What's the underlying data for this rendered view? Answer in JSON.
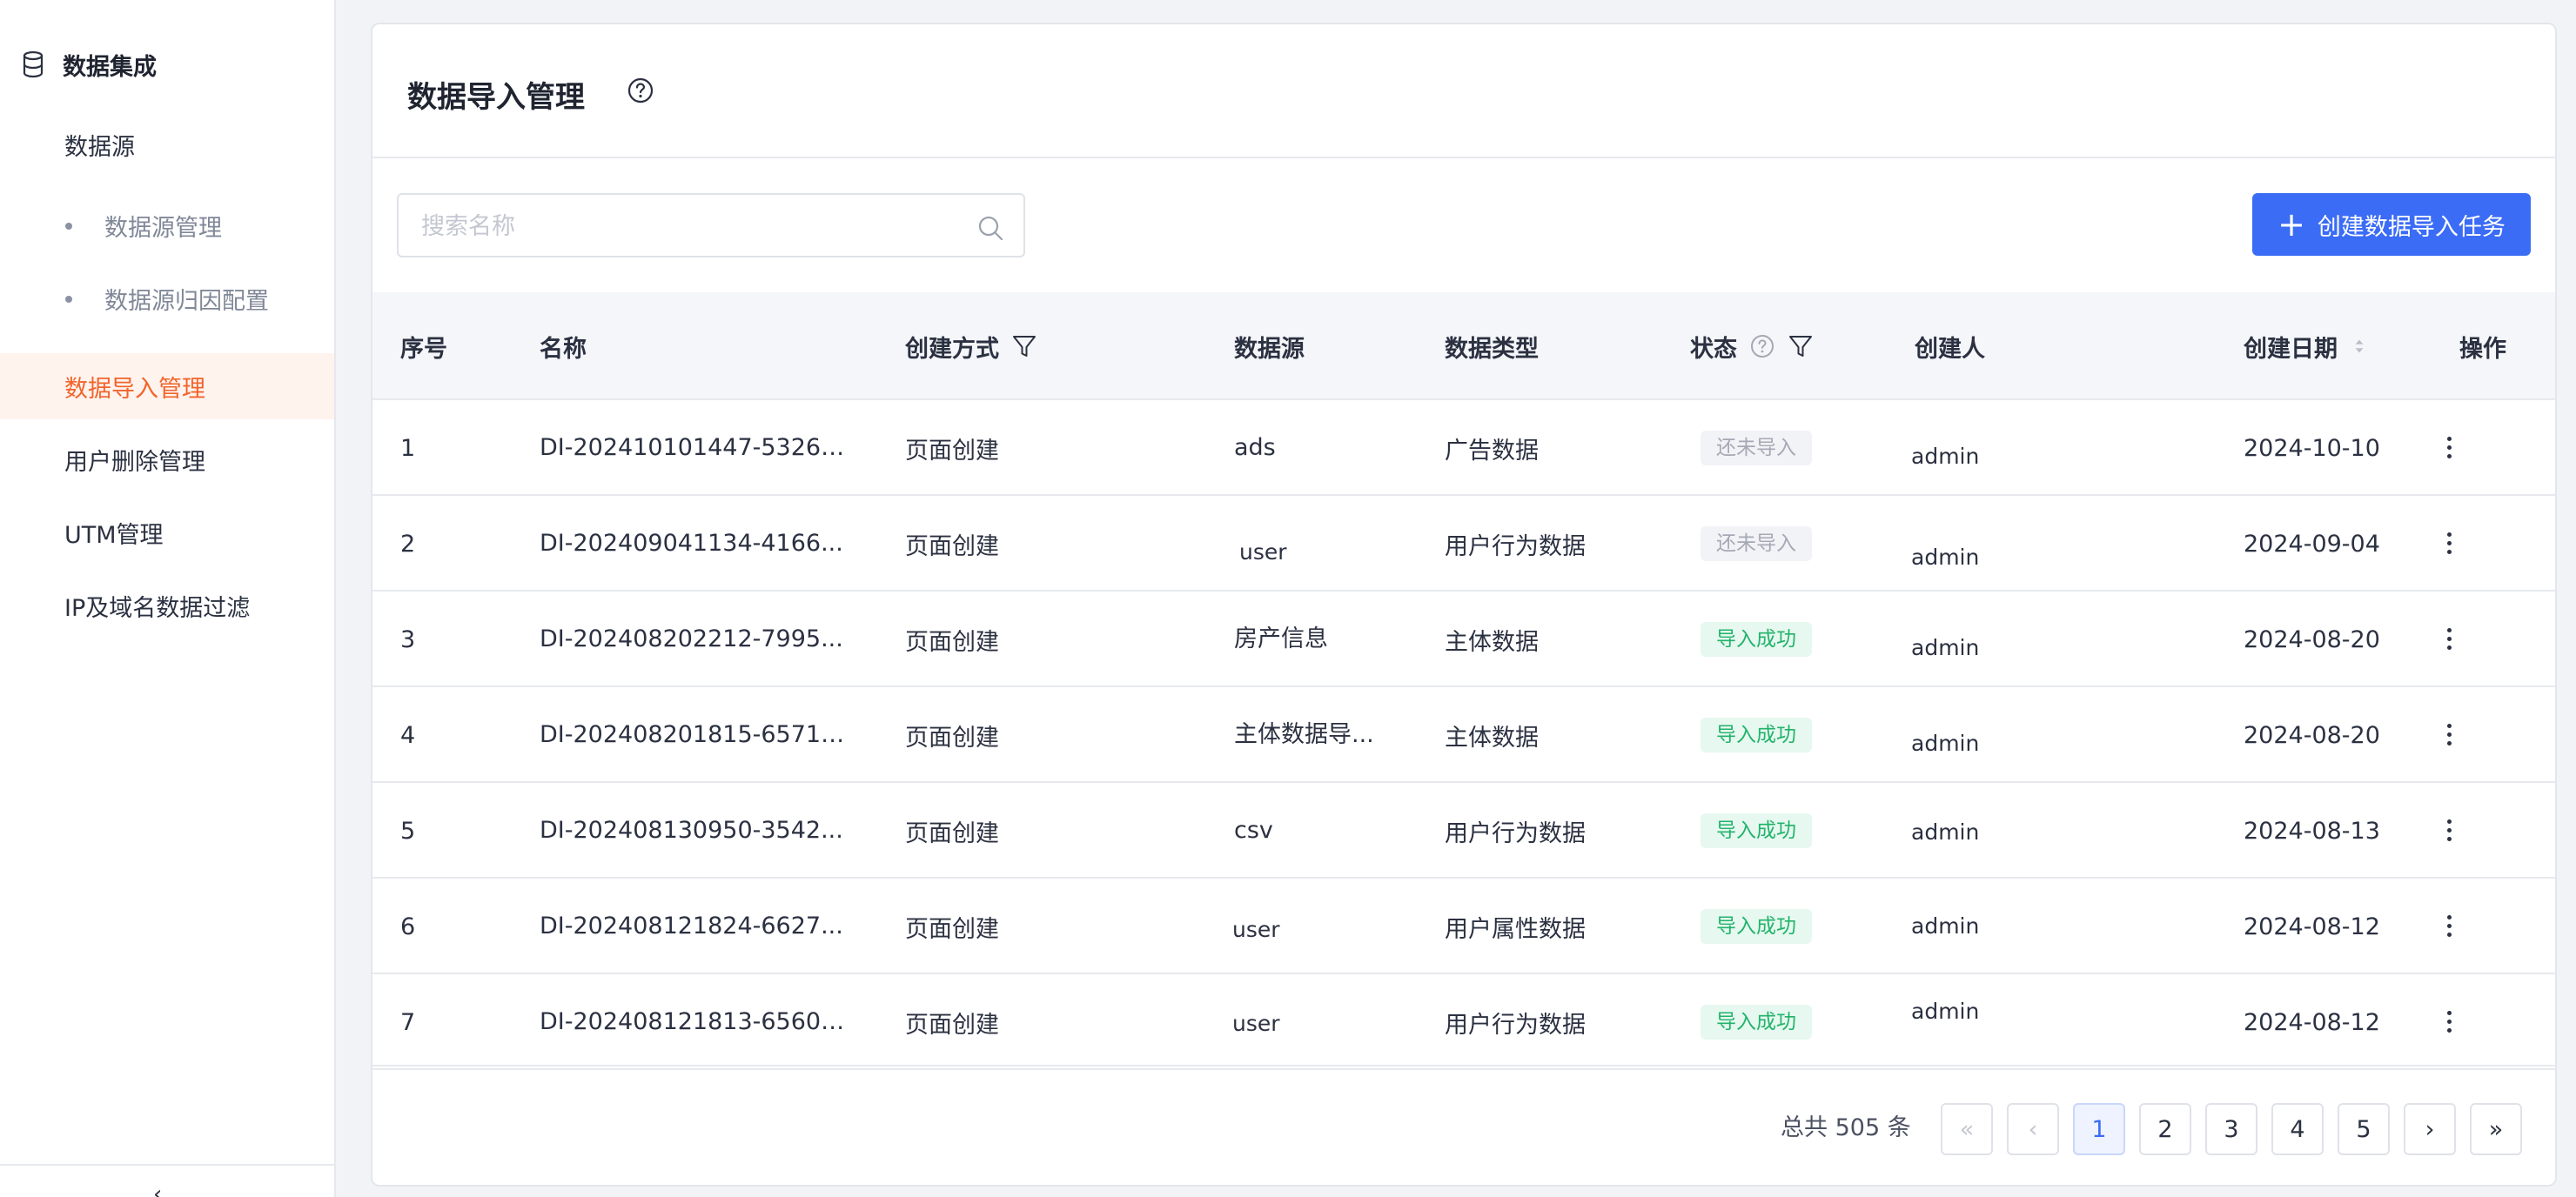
{
  "sidebar": {
    "group_title": "数据集成",
    "items": [
      {
        "label": "数据源"
      },
      {
        "label": "数据源管理"
      },
      {
        "label": "数据源归因配置"
      },
      {
        "label": "数据导入管理"
      },
      {
        "label": "用户删除管理"
      },
      {
        "label": "UTM管理"
      },
      {
        "label": "IP及域名数据过滤"
      }
    ],
    "collapse_glyph": "‹"
  },
  "page": {
    "title": "数据导入管理",
    "help_icon": "question-circle-icon"
  },
  "toolbar": {
    "search_placeholder": "搜索名称",
    "create_label": "创建数据导入任务",
    "create_glyph": "+"
  },
  "table": {
    "columns": [
      "序号",
      "名称",
      "创建方式",
      "数据源",
      "数据类型",
      "状态",
      "创建人",
      "创建日期",
      "操作"
    ],
    "rows": [
      {
        "index": "1",
        "name": "DI-202410101447-53265...",
        "method": "页面创建",
        "source": "ads",
        "type": "广告数据",
        "status": "还未导入",
        "status_kind": "pending",
        "creator": "admin",
        "date": "2024-10-10"
      },
      {
        "index": "2",
        "name": "DI-202409041134-4166...",
        "method": "页面创建",
        "source": "user",
        "type": "用户行为数据",
        "status": "还未导入",
        "status_kind": "pending",
        "creator": "admin",
        "date": "2024-09-04"
      },
      {
        "index": "3",
        "name": "DI-202408202212-7995...",
        "method": "页面创建",
        "source": "房产信息",
        "type": "主体数据",
        "status": "导入成功",
        "status_kind": "success",
        "creator": "admin",
        "date": "2024-08-20"
      },
      {
        "index": "4",
        "name": "DI-202408201815-65715...",
        "method": "页面创建",
        "source": "主体数据导...",
        "type": "主体数据",
        "status": "导入成功",
        "status_kind": "success",
        "creator": "admin",
        "date": "2024-08-20"
      },
      {
        "index": "5",
        "name": "DI-202408130950-3542...",
        "method": "页面创建",
        "source": "csv",
        "type": "用户行为数据",
        "status": "导入成功",
        "status_kind": "success",
        "creator": "admin",
        "date": "2024-08-13"
      },
      {
        "index": "6",
        "name": "DI-202408121824-6627...",
        "method": "页面创建",
        "source": "user",
        "type": "用户属性数据",
        "status": "导入成功",
        "status_kind": "success",
        "creator": "admin",
        "date": "2024-08-12"
      },
      {
        "index": "7",
        "name": "DI-202408121813-65601...",
        "method": "页面创建",
        "source": "user",
        "type": "用户行为数据",
        "status": "导入成功",
        "status_kind": "success",
        "creator": "admin",
        "date": "2024-08-12"
      }
    ]
  },
  "pagination": {
    "total_text": "总共 505 条",
    "pages": [
      "1",
      "2",
      "3",
      "4",
      "5"
    ],
    "current": "1",
    "first_glyph": "«",
    "prev_glyph": "‹",
    "next_glyph": "›",
    "last_glyph": "»"
  },
  "colors": {
    "accent": "#3b6cf6",
    "active_nav": "#f2642b",
    "success": "#22b36b",
    "pending": "#a4a9b5"
  }
}
